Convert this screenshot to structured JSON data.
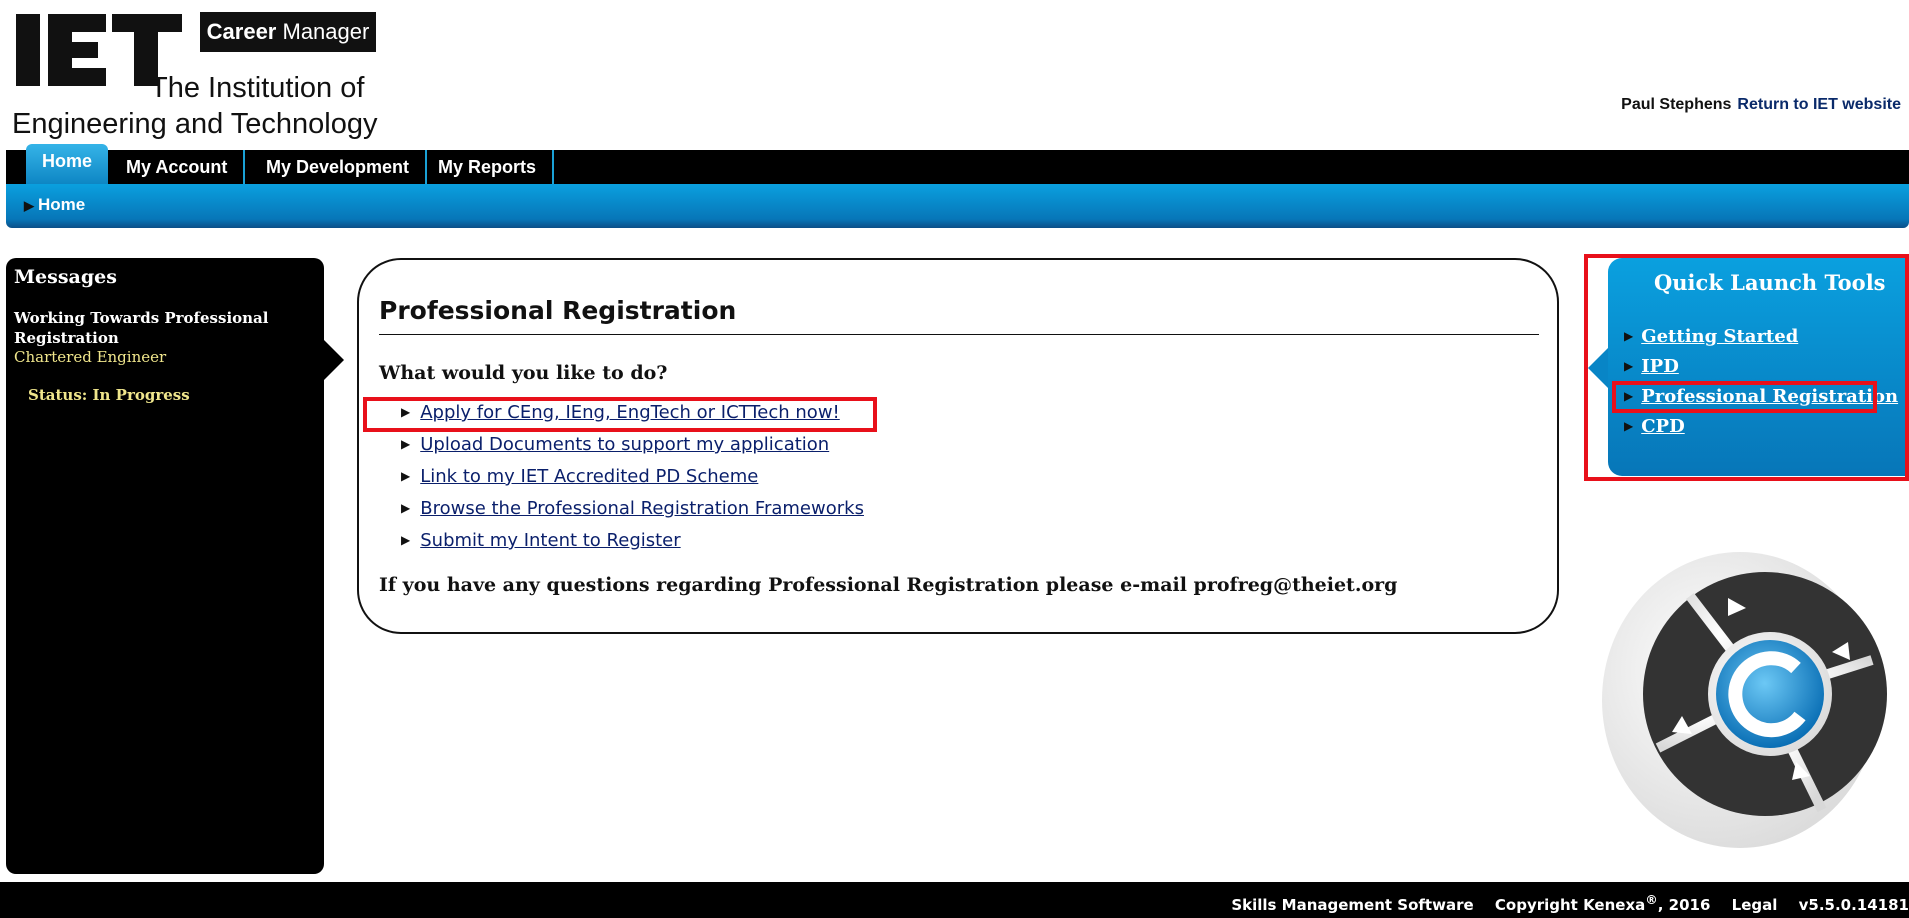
{
  "brand": {
    "logo_letters": "IET",
    "product_bold": "Career",
    "product_rest": " Manager",
    "inst_line1": "The Institution of",
    "inst_line2": "Engineering and Technology"
  },
  "user": {
    "name": "Paul Stephens",
    "return_link": "Return to IET website"
  },
  "nav": {
    "tabs": [
      {
        "label": "Home",
        "active": true
      },
      {
        "label": "My Account",
        "active": false
      },
      {
        "label": "My Development",
        "active": false
      },
      {
        "label": "My Reports",
        "active": false
      }
    ],
    "breadcrumb": "Home"
  },
  "messages": {
    "title": "Messages",
    "item_title": "Working Towards Professional Registration",
    "item_role": "Chartered Engineer",
    "item_status": "Status: In Progress"
  },
  "main": {
    "title": "Professional Registration",
    "question": "What would you like to do?",
    "links": [
      "Apply for CEng, IEng, EngTech or ICTTech now!",
      "Upload Documents to support my application",
      "Link to my IET Accredited PD Scheme",
      "Browse the Professional Registration Frameworks",
      "Submit my Intent to Register"
    ],
    "note": "If you have any questions regarding Professional Registration please e-mail profreg@theiet.org"
  },
  "quick_launch": {
    "title": "Quick Launch Tools",
    "items": [
      "Getting Started",
      "IPD",
      "Professional Registration",
      "CPD"
    ]
  },
  "footer": {
    "software": "Skills Management Software",
    "copyright_pre": "Copyright Kenexa",
    "copyright_sup": "®",
    "copyright_post": ", 2016",
    "legal": "Legal",
    "version": "v5.5.0.14181"
  },
  "colors": {
    "nav_blue": "#0aa0df",
    "highlight_red": "#e8101a",
    "link_navy": "#0a1f6b",
    "message_yellow": "#f0e68c"
  },
  "icons": [
    "triangle-right-icon",
    "kenexa-logo-icon"
  ]
}
